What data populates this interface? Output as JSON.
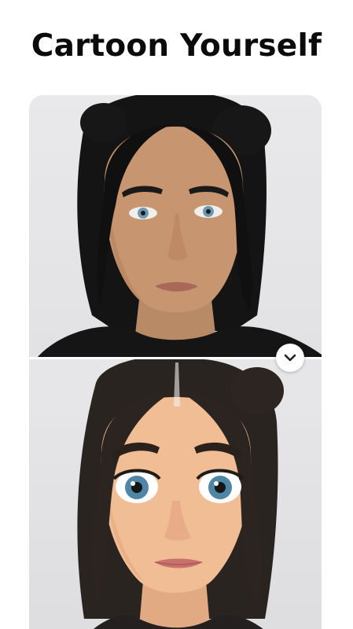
{
  "screen": {
    "title": "Cartoon Yourself"
  },
  "comparison": {
    "before_image": "original-photo-portrait",
    "after_image": "cartoon-avatar-portrait",
    "handle_icon": "chevron-down-icon"
  },
  "colors": {
    "background": "#ffffff",
    "panel_background": "#e4e4e6",
    "title_text": "#0b0b0b"
  }
}
